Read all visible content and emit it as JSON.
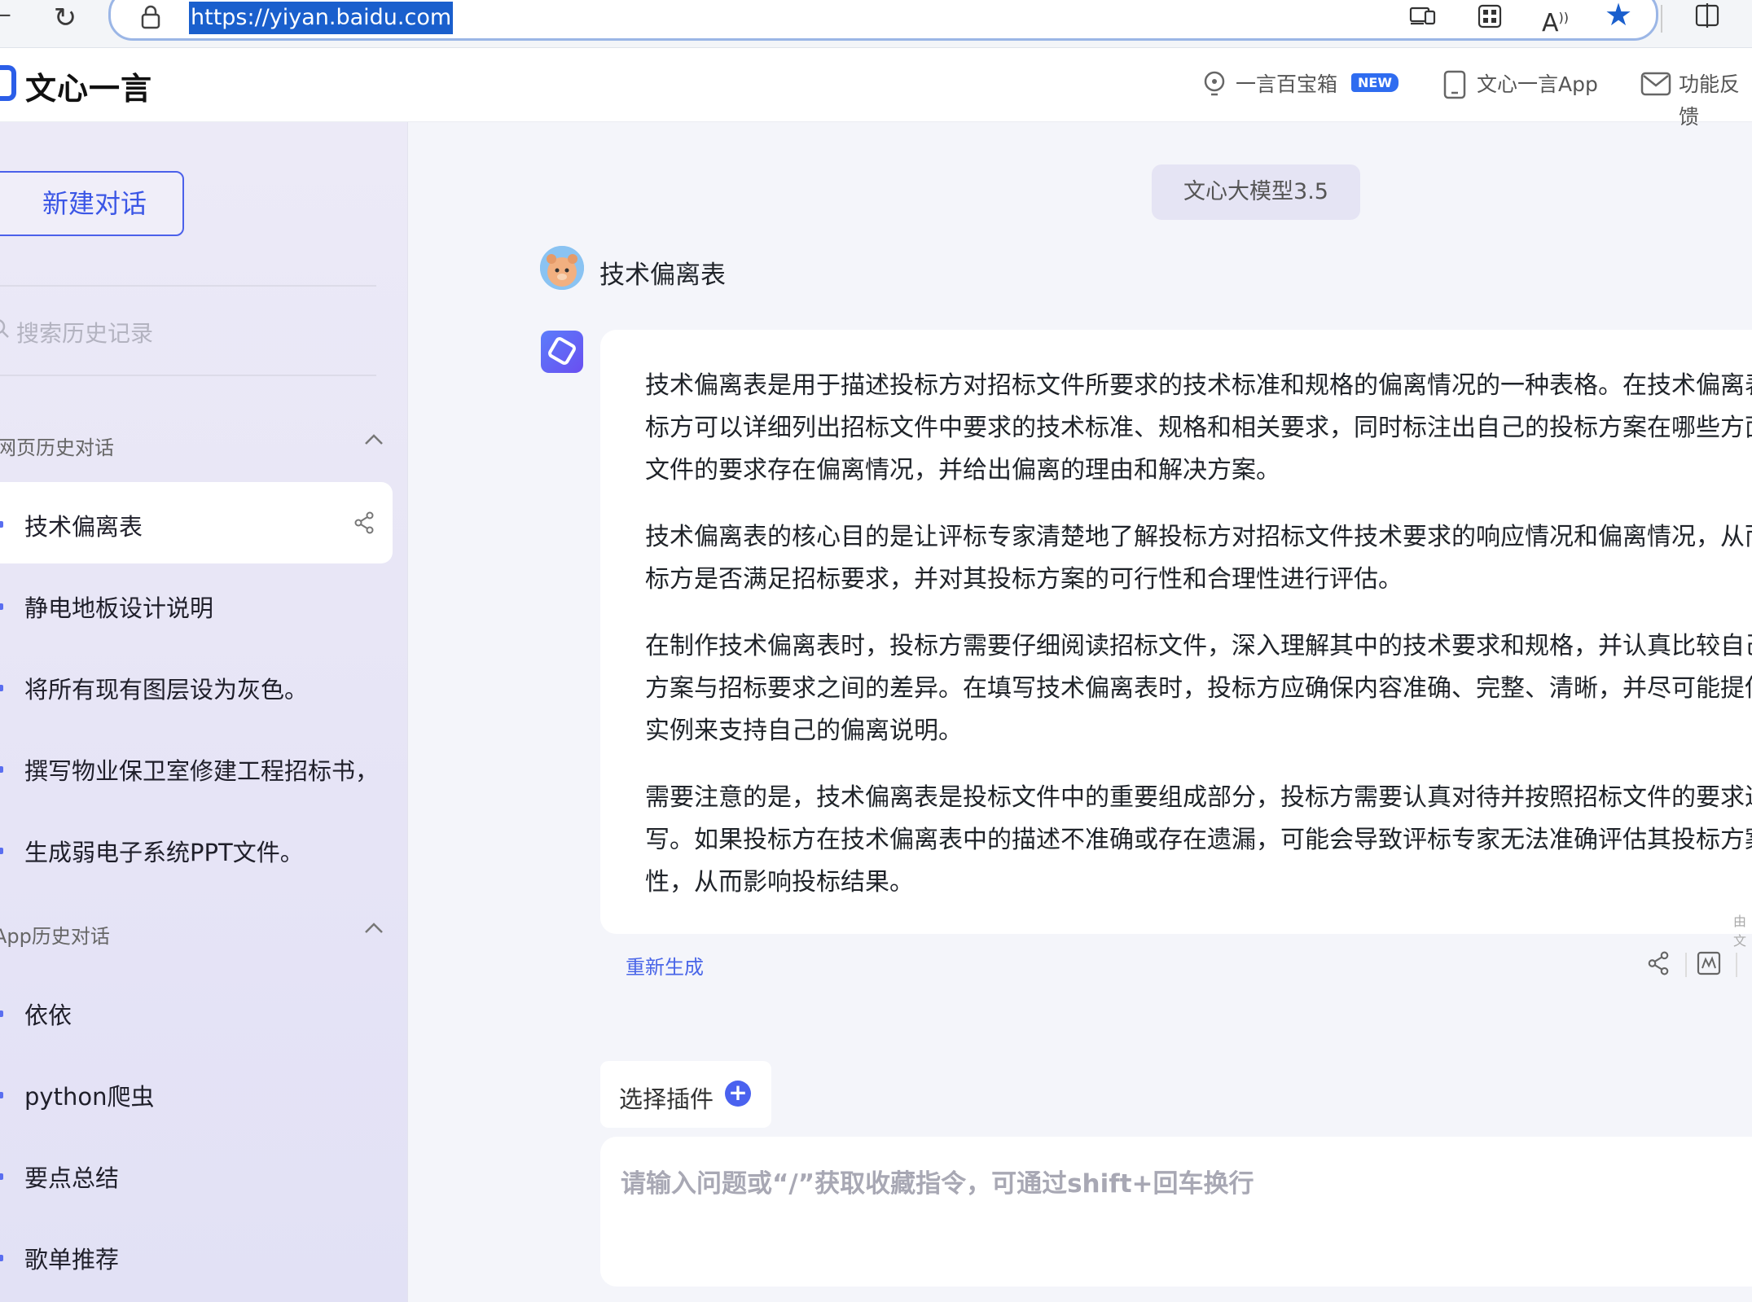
{
  "browser": {
    "url": "https://yiyan.baidu.com",
    "icons": [
      "reload-icon",
      "lock-icon",
      "read-aloud-icon",
      "apps-icon",
      "immersive-reader-icon",
      "favorite-star-icon",
      "split-screen-icon"
    ]
  },
  "header": {
    "logo": "文心一言",
    "nav": [
      {
        "label": "一言百宝箱",
        "badge": "NEW",
        "icon": "bulb-icon"
      },
      {
        "label": "文心一言App",
        "icon": "phone-icon"
      },
      {
        "label": "功能反馈",
        "icon": "mail-icon"
      }
    ]
  },
  "sidebar": {
    "new_chat": "新建对话",
    "search_placeholder": "搜索历史记录",
    "sections": [
      {
        "title": "网页历史对话",
        "items": [
          "技术偏离表",
          "静电地板设计说明",
          "将所有现有图层设为灰色。",
          "撰写物业保卫室修建工程招标书，",
          "生成弱电子系统PPT文件。"
        ]
      },
      {
        "title": "App历史对话",
        "items": [
          "依依",
          "python爬虫",
          "要点总结",
          "歌单推荐"
        ]
      }
    ]
  },
  "main": {
    "model": "文心大模型3.5",
    "user_message": "技术偏离表",
    "answer": [
      "技术偏离表是用于描述投标方对招标文件所要求的技术标准和规格的偏离情况的一种表格。在技术偏离表",
      "标方可以详细列出招标文件中要求的技术标准、规格和相关要求，同时标注出自己的投标方案在哪些方面",
      "文件的要求存在偏离情况，并给出偏离的理由和解决方案。",
      "技术偏离表的核心目的是让评标专家清楚地了解投标方对招标文件技术要求的响应情况和偏离情况，从而",
      "标方是否满足招标要求，并对其投标方案的可行性和合理性进行评估。",
      "在制作技术偏离表时，投标方需要仔细阅读招标文件，深入理解其中的技术要求和规格，并认真比较自己",
      "方案与招标要求之间的差异。在填写技术偏离表时，投标方应确保内容准确、完整、清晰，并尽可能提供",
      "实例来支持自己的偏离说明。",
      "需要注意的是，技术偏离表是投标文件中的重要组成部分，投标方需要认真对待并按照招标文件的要求进",
      "写。如果投标方在技术偏离表中的描述不准确或存在遗漏，可能会导致评标专家无法准确评估其投标方案",
      "性，从而影响投标结果。"
    ],
    "note": "由文",
    "regenerate": "重新生成",
    "plugin_label": "选择插件",
    "input_placeholder": "请输入问题或“/”获取收藏指令，可通过shift+回车换行"
  }
}
